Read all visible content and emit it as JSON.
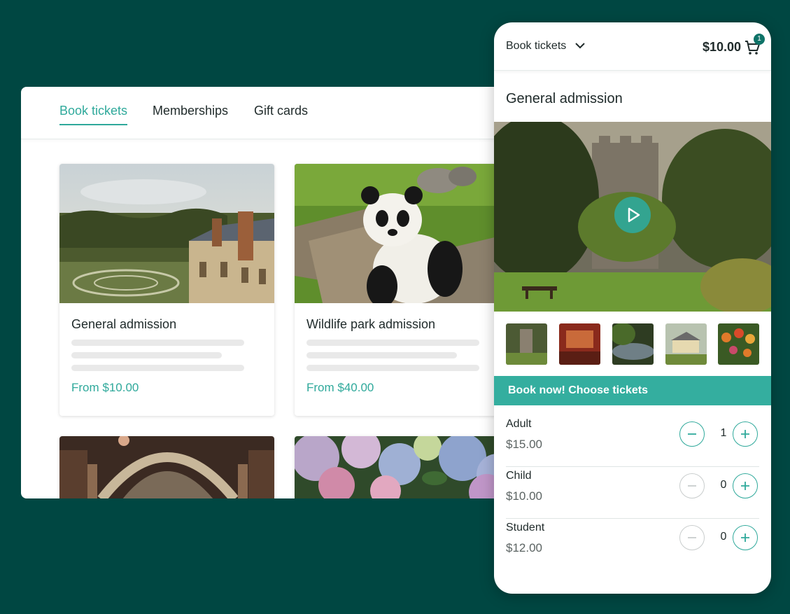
{
  "desktop": {
    "tabs": [
      {
        "label": "Book tickets",
        "active": true
      },
      {
        "label": "Memberships",
        "active": false
      },
      {
        "label": "Gift cards",
        "active": false
      }
    ],
    "cards": [
      {
        "title": "General admission",
        "price": "From $10.00",
        "image": "castle-garden-photo"
      },
      {
        "title": "Wildlife park admission",
        "price": "From $40.00",
        "image": "panda-photo"
      },
      {
        "title": "",
        "price": "",
        "image": "hall-interior-photo"
      },
      {
        "title": "",
        "price": "",
        "image": "hydrangea-photo"
      }
    ]
  },
  "mobile": {
    "menu_label": "Book tickets",
    "cart_total": "$10.00",
    "cart_count": "1",
    "section_title": "General admission",
    "book_now_label": "Book now! Choose tickets",
    "tickets": [
      {
        "type": "Adult",
        "price": "$15.00",
        "qty": "1"
      },
      {
        "type": "Child",
        "price": "$10.00",
        "qty": "0"
      },
      {
        "type": "Student",
        "price": "$12.00",
        "qty": "0"
      }
    ]
  },
  "colors": {
    "background": "#004742",
    "accent": "#2fa99b",
    "book_bar": "#34ae9f"
  }
}
